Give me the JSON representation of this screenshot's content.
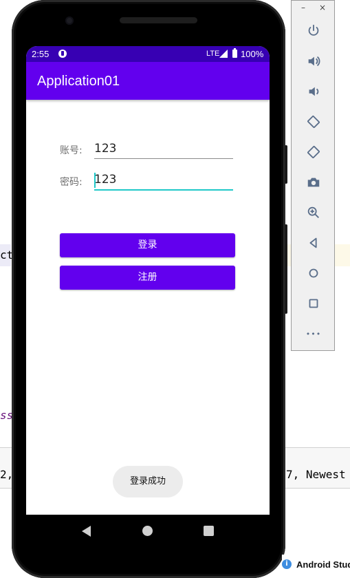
{
  "ide": {
    "line_fragment_left": "ct",
    "keyword_fragment": "ss",
    "log_fragment_left": "2,",
    "log_fragment_right": "7, Newest"
  },
  "status_bar": {
    "time": "2:55",
    "network": "LTE",
    "battery": "100%"
  },
  "app_bar": {
    "title": "Application01"
  },
  "form": {
    "account_label": "账号:",
    "account_value": "123",
    "password_label": "密码:",
    "password_value": "123"
  },
  "buttons": {
    "login": "登录",
    "register": "注册"
  },
  "toast": {
    "message": "登录成功"
  },
  "emulator_toolbar": {
    "minimize": "–",
    "close": "×",
    "more": "•••",
    "icons": [
      "power-icon",
      "volume-up-icon",
      "volume-down-icon",
      "rotate-left-icon",
      "rotate-right-icon",
      "camera-icon",
      "zoom-icon",
      "back-icon",
      "home-icon",
      "overview-icon",
      "more-icon"
    ]
  },
  "bottom_status": {
    "label": "Android Studi"
  },
  "colors": {
    "primary": "#6200ee",
    "primary_dark": "#3700b3",
    "accent": "#1ec8c8"
  }
}
